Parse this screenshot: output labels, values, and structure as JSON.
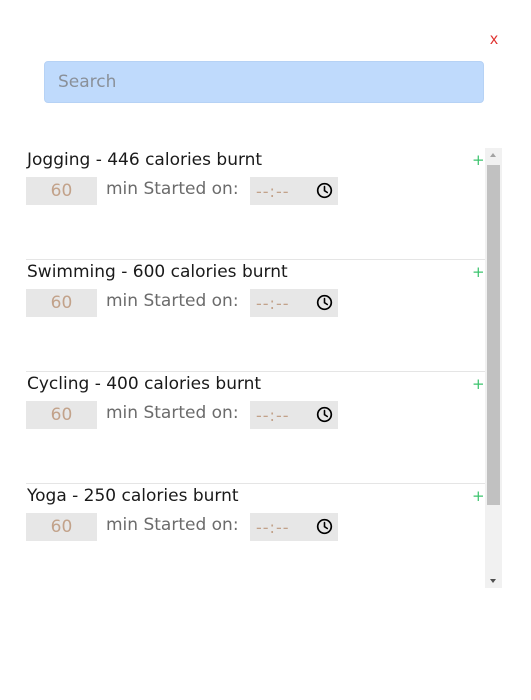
{
  "colors": {
    "close": "#e0312f",
    "add": "#3cc46e",
    "search_bg": "#bfdafc",
    "input_bg": "#e7e7e7",
    "minutes_text": "#c2a28a",
    "time_text": "#c2a28a"
  },
  "header": {
    "close_label": "x"
  },
  "search": {
    "placeholder": "Search",
    "value": ""
  },
  "activities": [
    {
      "title": "Jogging - 446 calories burnt",
      "minutes": "60",
      "min_label": "min Started on:",
      "time": "--:--",
      "add_label": "+"
    },
    {
      "title": "Swimming - 600 calories burnt",
      "minutes": "60",
      "min_label": "min Started on:",
      "time": "--:--",
      "add_label": "+"
    },
    {
      "title": "Cycling - 400 calories burnt",
      "minutes": "60",
      "min_label": "min Started on:",
      "time": "--:--",
      "add_label": "+"
    },
    {
      "title": "Yoga - 250 calories burnt",
      "minutes": "60",
      "min_label": "min Started on:",
      "time": "--:--",
      "add_label": "+"
    }
  ],
  "icons": {
    "clock": "clock-icon",
    "scroll_up": "scroll-up-arrow",
    "scroll_down": "scroll-down-arrow"
  }
}
